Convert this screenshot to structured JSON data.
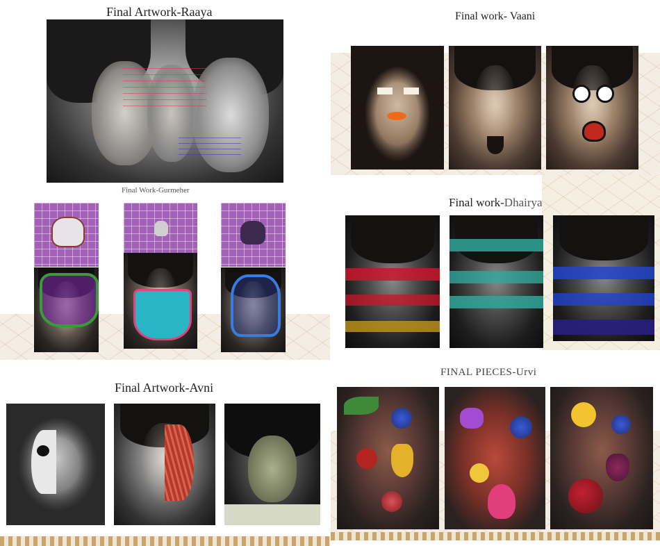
{
  "titles": {
    "raaya": "Final Artwork-Raaya",
    "vaani": "Final work- Vaani",
    "gurmeher": "Final Work-Gurmeher",
    "dhairya_prefix": "Final work-",
    "dhairya_name": "Dhairya",
    "avni": "Final Artwork-Avni",
    "urvi": "FINAL PIECES-Urvi"
  },
  "colors": {
    "background": "#ffffff",
    "grid_purple": "#a260b6",
    "dhairya_red": "#c8162a",
    "dhairya_teal": "#2fa79a",
    "dhairya_blue": "#2244c8"
  }
}
